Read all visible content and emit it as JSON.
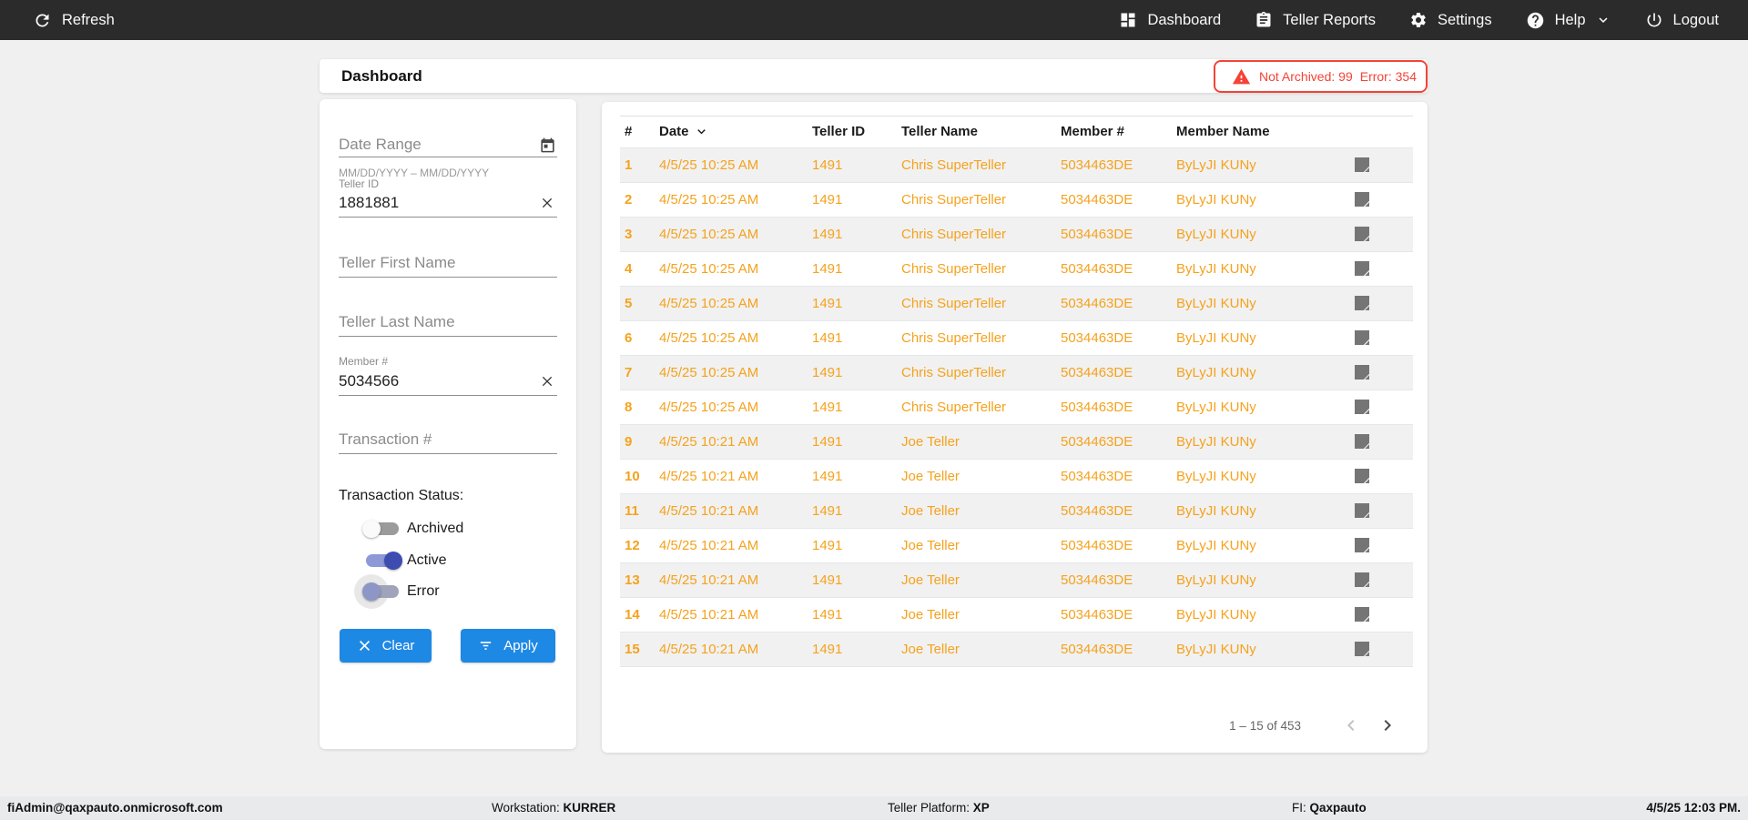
{
  "nav": {
    "refresh_label": "Refresh",
    "items": [
      {
        "label": "Dashboard"
      },
      {
        "label": "Teller Reports"
      },
      {
        "label": "Settings"
      },
      {
        "label": "Help"
      },
      {
        "label": "Logout"
      }
    ]
  },
  "page": {
    "title": "Dashboard"
  },
  "alert": {
    "not_archived": "Not Archived: 99",
    "error": "Error: 354"
  },
  "filters": {
    "date_range": {
      "placeholder": "Date Range",
      "hint": "MM/DD/YYYY – MM/DD/YYYY"
    },
    "teller_id": {
      "label": "Teller ID",
      "value": "1881881"
    },
    "teller_first_name": {
      "placeholder": "Teller First Name"
    },
    "teller_last_name": {
      "placeholder": "Teller Last Name"
    },
    "member_number": {
      "label": "Member #",
      "value": "5034566"
    },
    "transaction_number": {
      "placeholder": "Transaction #"
    },
    "status": {
      "label": "Transaction Status:",
      "toggles": [
        {
          "label": "Archived",
          "state": "off"
        },
        {
          "label": "Active",
          "state": "on"
        },
        {
          "label": "Error",
          "state": "off-ripple"
        }
      ]
    },
    "clear_label": "Clear",
    "apply_label": "Apply"
  },
  "table": {
    "columns": [
      "#",
      "Date",
      "Teller ID",
      "Teller Name",
      "Member #",
      "Member Name"
    ],
    "sorted_by": "Date",
    "rows": [
      {
        "num": "1",
        "date": "4/5/25 10:25 AM",
        "teller_id": "1491",
        "teller_name": "Chris SuperTeller",
        "member_number": "5034463DE",
        "member_name": "ByLyJI KUNy"
      },
      {
        "num": "2",
        "date": "4/5/25 10:25 AM",
        "teller_id": "1491",
        "teller_name": "Chris SuperTeller",
        "member_number": "5034463DE",
        "member_name": "ByLyJI KUNy"
      },
      {
        "num": "3",
        "date": "4/5/25 10:25 AM",
        "teller_id": "1491",
        "teller_name": "Chris SuperTeller",
        "member_number": "5034463DE",
        "member_name": "ByLyJI KUNy"
      },
      {
        "num": "4",
        "date": "4/5/25 10:25 AM",
        "teller_id": "1491",
        "teller_name": "Chris SuperTeller",
        "member_number": "5034463DE",
        "member_name": "ByLyJI KUNy"
      },
      {
        "num": "5",
        "date": "4/5/25 10:25 AM",
        "teller_id": "1491",
        "teller_name": "Chris SuperTeller",
        "member_number": "5034463DE",
        "member_name": "ByLyJI KUNy"
      },
      {
        "num": "6",
        "date": "4/5/25 10:25 AM",
        "teller_id": "1491",
        "teller_name": "Chris SuperTeller",
        "member_number": "5034463DE",
        "member_name": "ByLyJI KUNy"
      },
      {
        "num": "7",
        "date": "4/5/25 10:25 AM",
        "teller_id": "1491",
        "teller_name": "Chris SuperTeller",
        "member_number": "5034463DE",
        "member_name": "ByLyJI KUNy"
      },
      {
        "num": "8",
        "date": "4/5/25 10:25 AM",
        "teller_id": "1491",
        "teller_name": "Chris SuperTeller",
        "member_number": "5034463DE",
        "member_name": "ByLyJI KUNy"
      },
      {
        "num": "9",
        "date": "4/5/25 10:21 AM",
        "teller_id": "1491",
        "teller_name": "Joe Teller",
        "member_number": "5034463DE",
        "member_name": "ByLyJI KUNy"
      },
      {
        "num": "10",
        "date": "4/5/25 10:21 AM",
        "teller_id": "1491",
        "teller_name": "Joe Teller",
        "member_number": "5034463DE",
        "member_name": "ByLyJI KUNy"
      },
      {
        "num": "11",
        "date": "4/5/25 10:21 AM",
        "teller_id": "1491",
        "teller_name": "Joe Teller",
        "member_number": "5034463DE",
        "member_name": "ByLyJI KUNy"
      },
      {
        "num": "12",
        "date": "4/5/25 10:21 AM",
        "teller_id": "1491",
        "teller_name": "Joe Teller",
        "member_number": "5034463DE",
        "member_name": "ByLyJI KUNy"
      },
      {
        "num": "13",
        "date": "4/5/25 10:21 AM",
        "teller_id": "1491",
        "teller_name": "Joe Teller",
        "member_number": "5034463DE",
        "member_name": "ByLyJI KUNy"
      },
      {
        "num": "14",
        "date": "4/5/25 10:21 AM",
        "teller_id": "1491",
        "teller_name": "Joe Teller",
        "member_number": "5034463DE",
        "member_name": "ByLyJI KUNy"
      },
      {
        "num": "15",
        "date": "4/5/25 10:21 AM",
        "teller_id": "1491",
        "teller_name": "Joe Teller",
        "member_number": "5034463DE",
        "member_name": "ByLyJI KUNy"
      }
    ],
    "paginator": {
      "range_label": "1 – 15 of 453"
    }
  },
  "footer": {
    "user": "fiAdmin@qaxpauto.onmicrosoft.com",
    "workstation_label": "Workstation: ",
    "workstation": "KURRER",
    "platform_label": "Teller Platform: ",
    "platform": "XP",
    "fi_label": "FI: ",
    "fi": "Qaxpauto",
    "datetime": "4/5/25 12:03 PM."
  },
  "colors": {
    "accent_blue": "#1e88e5",
    "row_orange": "#f5a21d",
    "alert_red": "#f44336",
    "toggle_on": "#3c4cb1",
    "navbar_bg": "#2b2b2b"
  }
}
